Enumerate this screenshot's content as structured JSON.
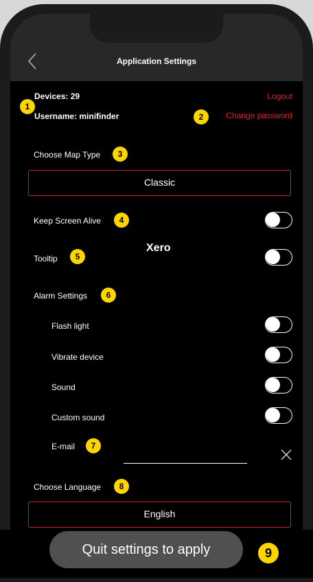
{
  "header": {
    "title": "Application Settings"
  },
  "account": {
    "devices_label": "Devices: 29",
    "username_label": "Username: minifinder",
    "logout_label": "Logout",
    "change_password_label": "Change password"
  },
  "map_type": {
    "label": "Choose Map Type",
    "value": "Classic"
  },
  "keep_screen_alive": {
    "label": "Keep Screen Alive",
    "on": false
  },
  "tooltip": {
    "label": "Tooltip",
    "on": false
  },
  "watermark": "Xero",
  "alarm_settings": {
    "label": "Alarm Settings",
    "items": [
      {
        "label": "Flash light",
        "on": false
      },
      {
        "label": "Vibrate device",
        "on": false
      },
      {
        "label": "Sound",
        "on": false
      },
      {
        "label": "Custom sound",
        "on": false
      }
    ],
    "email_label": "E-mail",
    "email_value": ""
  },
  "language": {
    "label": "Choose Language",
    "value": "English"
  },
  "toast": {
    "text": "Quit settings to apply"
  },
  "badges": [
    "1",
    "2",
    "3",
    "4",
    "5",
    "6",
    "7",
    "8",
    "9"
  ],
  "colors": {
    "accent_red": "#e0212b",
    "badge_yellow": "#ffd500",
    "toggle_off": "#000000"
  }
}
